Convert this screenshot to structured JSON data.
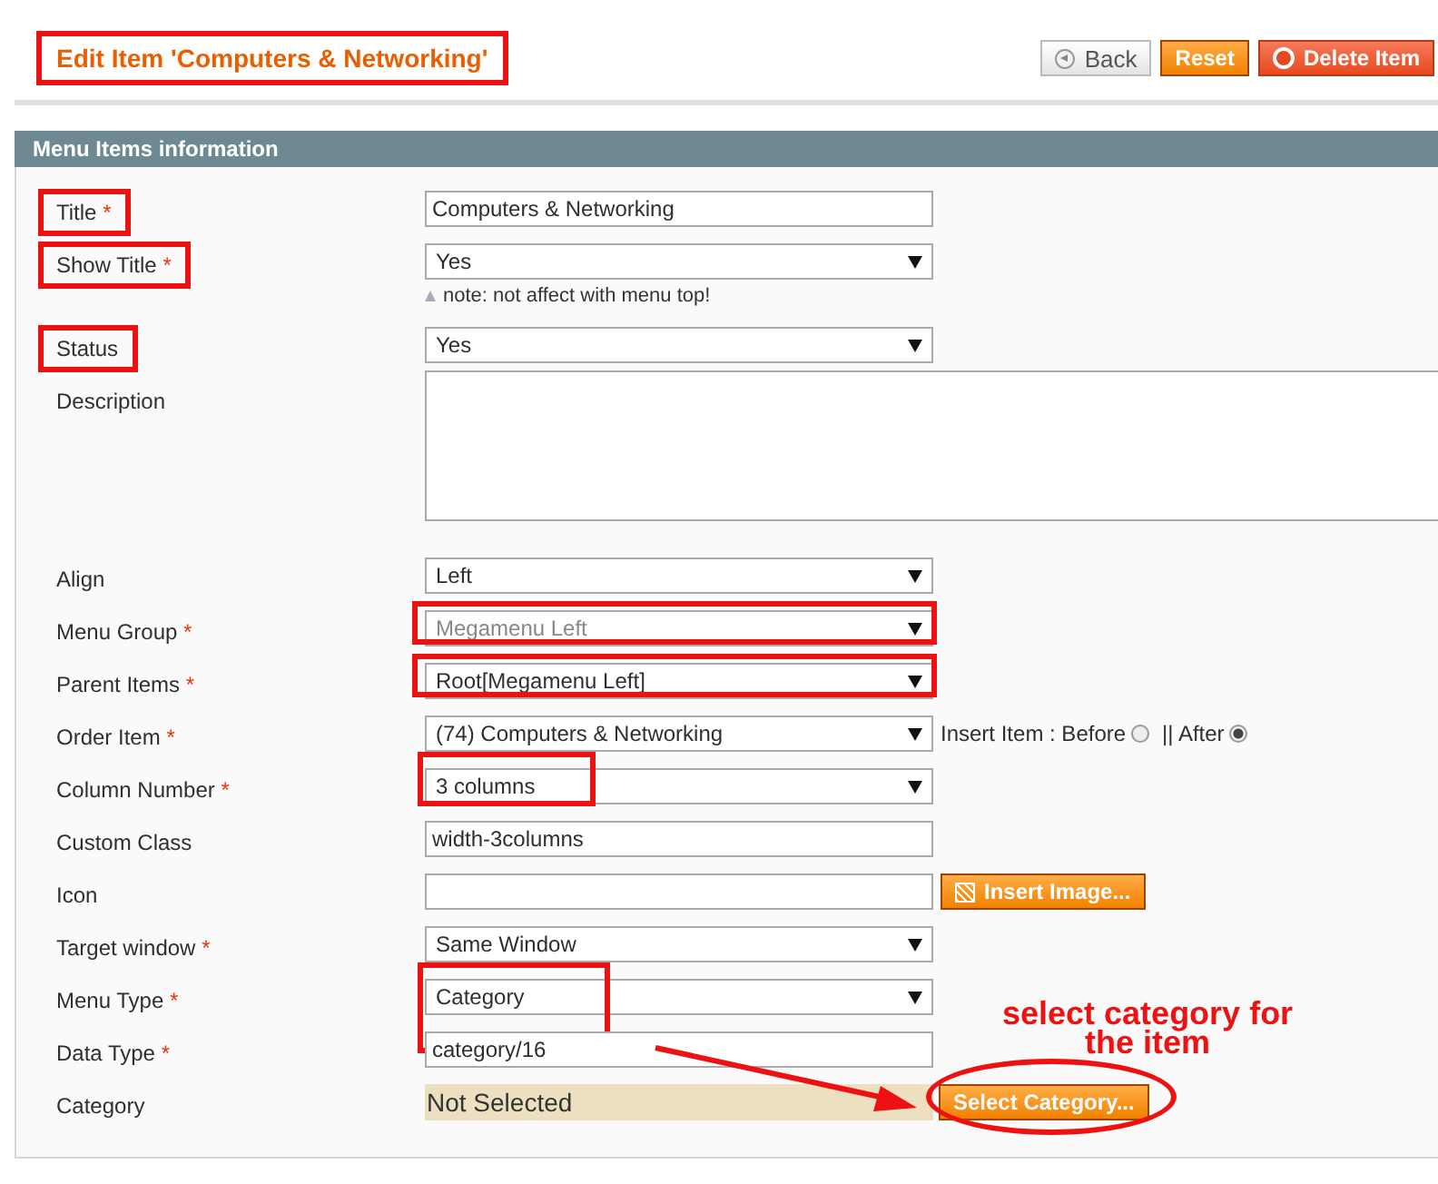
{
  "header": {
    "title": "Edit Item 'Computers & Networking'",
    "title_highlighted": true,
    "buttons": [
      {
        "label": "Back",
        "kind": "back"
      },
      {
        "label": "Reset",
        "kind": "plain"
      },
      {
        "label": "Delete Item",
        "kind": "delete"
      }
    ]
  },
  "section": {
    "title": "Menu Items information",
    "rows": [
      {
        "label": "Title",
        "required": "*",
        "label_highlighted": true,
        "kind": "text",
        "value": "Computers & Networking"
      },
      {
        "label": "Show Title",
        "required": "*",
        "label_highlighted": true,
        "kind": "select",
        "value": "Yes",
        "note": "note: not affect with menu top!"
      },
      {
        "label": "Status",
        "label_highlighted": true,
        "kind": "select",
        "value": "Yes"
      },
      {
        "label": "Description",
        "kind": "textarea"
      },
      {
        "label": "Align",
        "kind": "select",
        "value": "Left"
      },
      {
        "label": "Menu Group",
        "required": "*",
        "kind": "select",
        "value": "Megamenu Left",
        "disabled": true,
        "field_highlight": {
          "kind": "full"
        }
      },
      {
        "label": "Parent Items",
        "required": "*",
        "kind": "select",
        "value": "Root[Megamenu Left]",
        "field_highlight": {
          "kind": "full"
        }
      },
      {
        "label": "Order Item",
        "required": "*",
        "kind": "select_radios",
        "value": "(74) Computers & Networking",
        "radios": [
          {
            "label": "Insert Item : Before",
            "selected": false
          },
          {
            "label": "|| After",
            "selected": true
          }
        ]
      },
      {
        "label": "Column Number",
        "required": "*",
        "kind": "select",
        "value": "3 columns",
        "field_highlight": {
          "kind": "partial"
        }
      },
      {
        "label": "Custom Class",
        "kind": "text",
        "value": "width-3columns"
      },
      {
        "label": "Icon",
        "kind": "input_button",
        "button": "Insert Image..."
      },
      {
        "label": "Target window",
        "required": "*",
        "kind": "select",
        "value": "Same Window"
      },
      {
        "label": "Menu Type",
        "required": "*",
        "kind": "select",
        "value": "Category",
        "field_highlight": {
          "kind": "partial-2rows"
        }
      },
      {
        "label": "Data Type",
        "required": "*",
        "kind": "text",
        "value": "category/16"
      },
      {
        "label": "Category",
        "kind": "category",
        "value": "Not Selected",
        "button": "Select Category...",
        "callout": [
          "select category for",
          "the item"
        ]
      }
    ]
  }
}
